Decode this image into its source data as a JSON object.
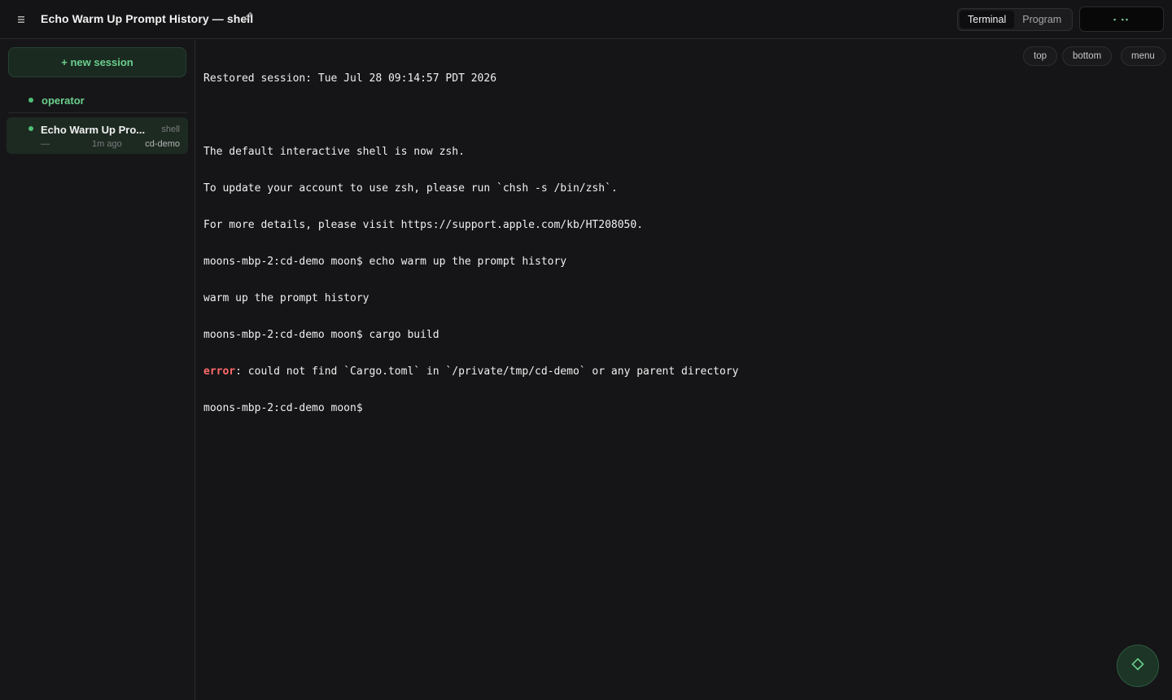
{
  "header": {
    "menu_icon": "hamburger-icon",
    "title": "Echo Warm Up Prompt History — shell",
    "edit_icon": "pencil-icon",
    "modes": [
      "Terminal",
      "Program"
    ],
    "active_mode": "Terminal",
    "status_indicator": "▪ ▪▪"
  },
  "sidebar": {
    "new_session_label": "+ new session",
    "operator_label": "operator",
    "sessions": [
      {
        "name": "Echo Warm Up Pro...",
        "kind": "shell",
        "dash": "—",
        "time": "1m ago",
        "dir": "cd-demo"
      }
    ]
  },
  "terminal": {
    "controls": {
      "top": "top",
      "bottom": "bottom",
      "menu": "menu"
    },
    "lines": [
      "Restored session: Tue Jul 28 09:14:57 PDT 2026",
      "",
      "The default interactive shell is now zsh.",
      "To update your account to use zsh, please run `chsh -s /bin/zsh`.",
      "For more details, please visit https://support.apple.com/kb/HT208050.",
      "moons-mbp-2:cd-demo moon$ echo warm up the prompt history",
      "warm up the prompt history",
      "moons-mbp-2:cd-demo moon$ cargo build"
    ],
    "error_label": "error",
    "error_text": ": could not find `Cargo.toml` in `/private/tmp/cd-demo` or any parent directory",
    "prompt_line": "moons-mbp-2:cd-demo moon$ "
  },
  "fab": {
    "icon": "diamond-icon"
  },
  "colors": {
    "accent": "#6bcf8c",
    "status_dot": "#4fbf76",
    "error": "#ff6b6b",
    "background": "#151517"
  }
}
